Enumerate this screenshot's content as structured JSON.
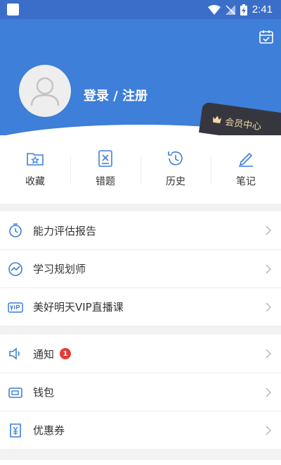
{
  "status_bar": {
    "time": "2:41"
  },
  "header": {
    "login_label": "登录 / 注册",
    "vip_label": "会员中心"
  },
  "quick_actions": [
    {
      "label": "收藏",
      "icon": "star-folder-icon"
    },
    {
      "label": "错题",
      "icon": "wrong-question-icon"
    },
    {
      "label": "历史",
      "icon": "history-clock-icon"
    },
    {
      "label": "笔记",
      "icon": "pencil-icon"
    }
  ],
  "menu_group_1": [
    {
      "label": "能力评估报告",
      "icon": "stopwatch-icon"
    },
    {
      "label": "学习规划师",
      "icon": "trend-circle-icon"
    },
    {
      "label": "美好明天VIP直播课",
      "icon": "vip-icon"
    }
  ],
  "menu_group_2": [
    {
      "label": "通知",
      "icon": "speaker-icon",
      "badge": "1"
    },
    {
      "label": "钱包",
      "icon": "wallet-icon"
    },
    {
      "label": "优惠券",
      "icon": "coupon-icon"
    }
  ],
  "colors": {
    "primary": "#3d7fd9",
    "status_bar": "#3a6ec9",
    "badge": "#e53935",
    "vip_gold": "#f3d9a6"
  }
}
